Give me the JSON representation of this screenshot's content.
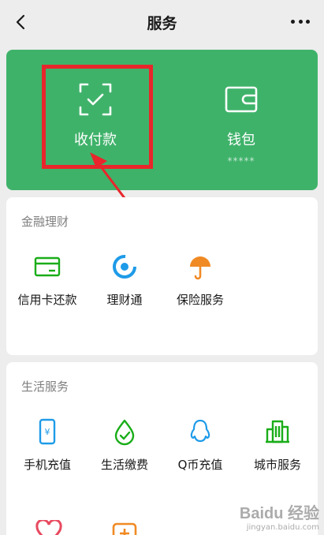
{
  "header": {
    "title": "服务"
  },
  "wallet_card": {
    "pay_label": "收付款",
    "wallet_label": "钱包",
    "wallet_balance_masked": "*****"
  },
  "finance": {
    "title": "金融理财",
    "items": [
      {
        "label": "信用卡还款",
        "icon": "credit-card-icon"
      },
      {
        "label": "理财通",
        "icon": "licaitong-icon"
      },
      {
        "label": "保险服务",
        "icon": "umbrella-icon"
      }
    ]
  },
  "life": {
    "title": "生活服务",
    "items": [
      {
        "label": "手机充值",
        "icon": "mobile-recharge-icon"
      },
      {
        "label": "生活缴费",
        "icon": "utility-payment-icon"
      },
      {
        "label": "Q币充值",
        "icon": "qq-penguin-icon"
      },
      {
        "label": "城市服务",
        "icon": "city-buildings-icon"
      }
    ]
  },
  "colors": {
    "accent": "#3fb26a",
    "annotation": "#e8262b",
    "background": "#ededed"
  },
  "watermark": {
    "brand": "Baidu 经验",
    "url": "jingyan.baidu.com"
  }
}
